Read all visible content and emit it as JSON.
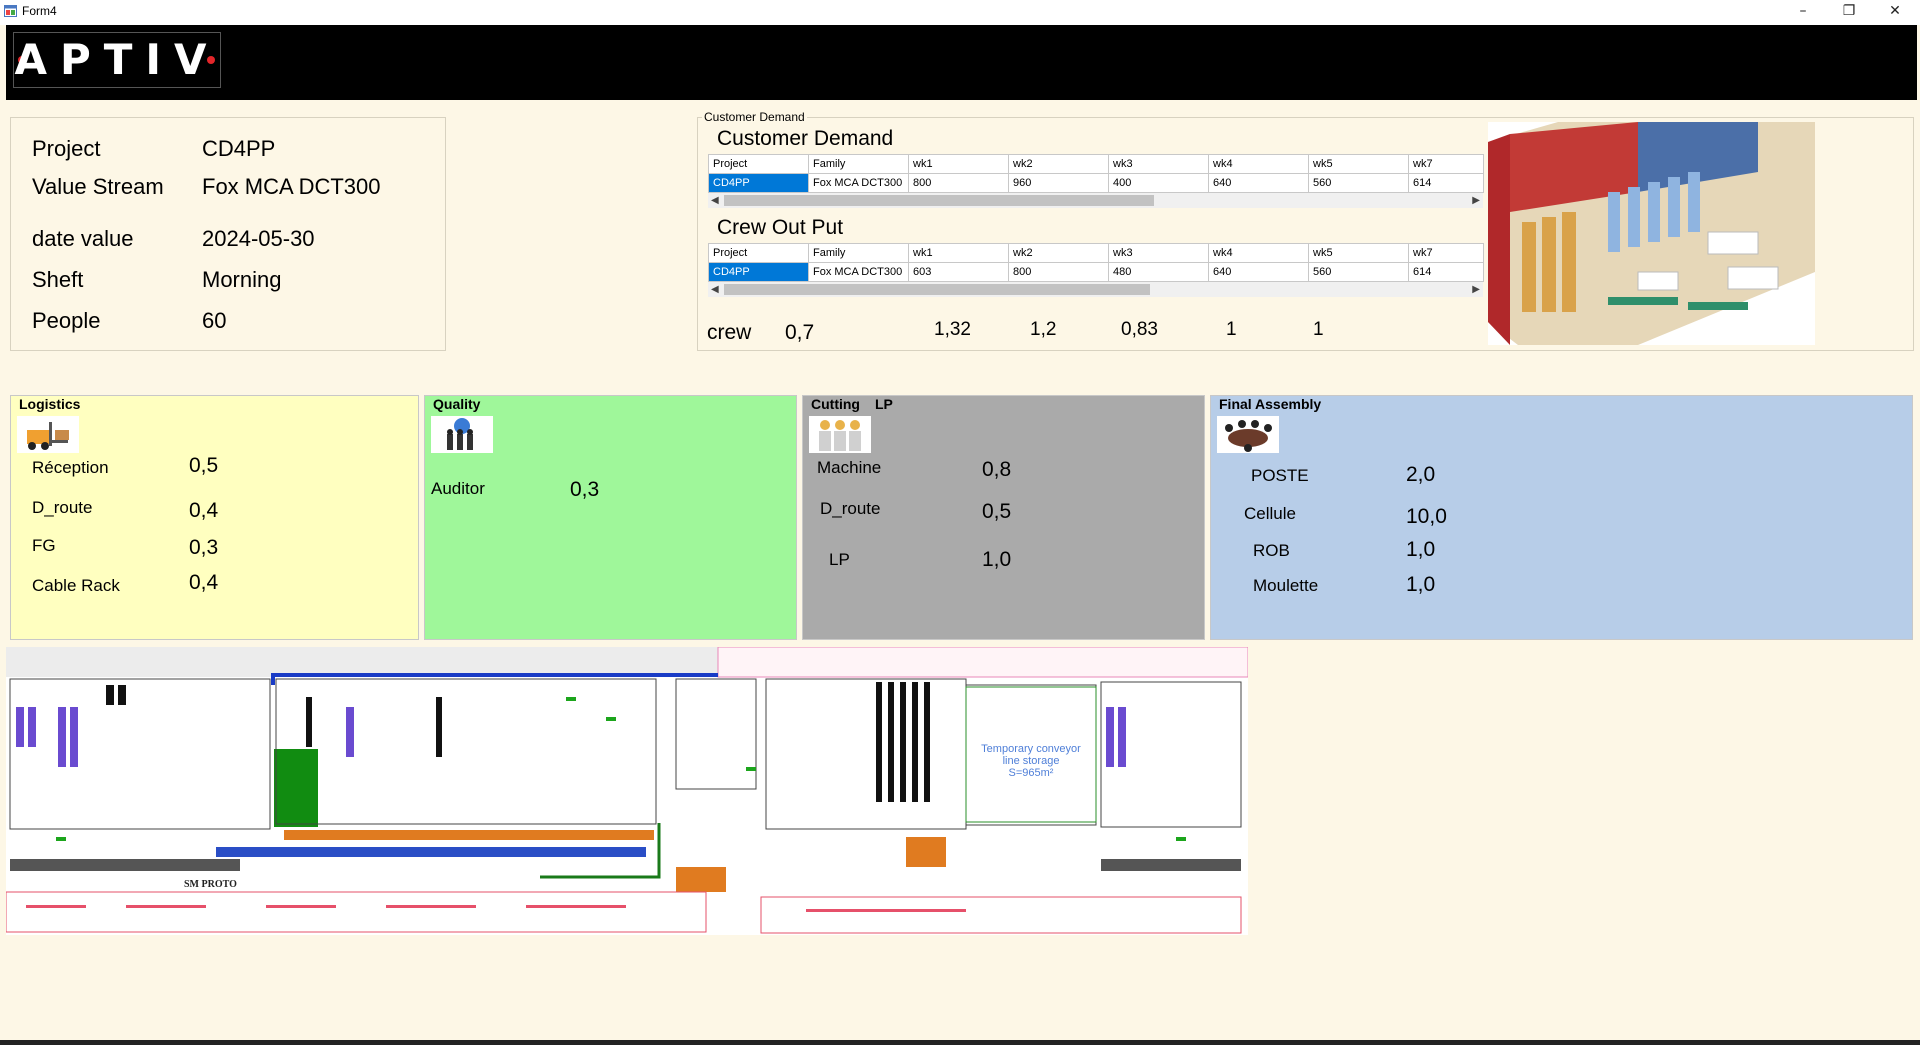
{
  "window": {
    "title": "Form4",
    "minimize": "–",
    "maximize": "❐",
    "close": "✕"
  },
  "logo": {
    "text": "APTIV"
  },
  "info": {
    "project_label": "Project",
    "project_value": "CD4PP",
    "value_stream_label": "Value Stream",
    "value_stream_value": "Fox MCA DCT300",
    "date_label": "date value",
    "date_value": "2024-05-30",
    "shift_label": "Sheft",
    "shift_value": "Morning",
    "people_label": "People",
    "people_value": "60"
  },
  "customer_demand": {
    "group_label": "Customer Demand",
    "title": "Customer Demand",
    "columns": [
      "Project",
      "Family",
      "wk1",
      "wk2",
      "wk3",
      "wk4",
      "wk5",
      "wk7"
    ],
    "rows": [
      [
        "CD4PP",
        "Fox MCA DCT300",
        "800",
        "960",
        "400",
        "640",
        "560",
        "614"
      ]
    ]
  },
  "crew_output": {
    "title": "Crew Out Put",
    "columns": [
      "Project",
      "Family",
      "wk1",
      "wk2",
      "wk3",
      "wk4",
      "wk5",
      "wk7"
    ],
    "rows": [
      [
        "CD4PP",
        "Fox MCA DCT300",
        "603",
        "800",
        "480",
        "640",
        "560",
        "614"
      ]
    ]
  },
  "crew": {
    "label": "crew",
    "values": [
      "0,7",
      "1,32",
      "1,2",
      "0,83",
      "1",
      "1"
    ]
  },
  "logistics": {
    "title": "Logistics",
    "icon": "forklift-icon",
    "color": "#ffffc0",
    "items": [
      {
        "label": "Réception",
        "value": "0,5"
      },
      {
        "label": "D_route",
        "value": "0,4"
      },
      {
        "label": "FG",
        "value": "0,3"
      },
      {
        "label": "Cable Rack",
        "value": "0,4"
      }
    ]
  },
  "quality": {
    "title": "Quality",
    "icon": "team-globe-icon",
    "color": "#9ff79a",
    "items": [
      {
        "label": "Auditor",
        "value": "0,3"
      }
    ]
  },
  "cutting": {
    "title": "Cutting",
    "subtitle": "LP",
    "icon": "workers-icon",
    "color": "#aaaaaa",
    "items": [
      {
        "label": "Machine",
        "value": "0,8"
      },
      {
        "label": "D_route",
        "value": "0,5"
      },
      {
        "label": "LP",
        "value": "1,0"
      }
    ]
  },
  "final_assembly": {
    "title": "Final Assembly",
    "icon": "meeting-icon",
    "color": "#b7cde8",
    "items": [
      {
        "label": "POSTE",
        "value": "2,0"
      },
      {
        "label": "Cellule",
        "value": "10,0"
      },
      {
        "label": "ROB",
        "value": "1,0"
      },
      {
        "label": "Moulette",
        "value": "1,0"
      }
    ]
  },
  "layout_plan": {
    "labels": [
      "SM PROTO",
      "Temporary conveyor line storage S=965m²"
    ]
  }
}
